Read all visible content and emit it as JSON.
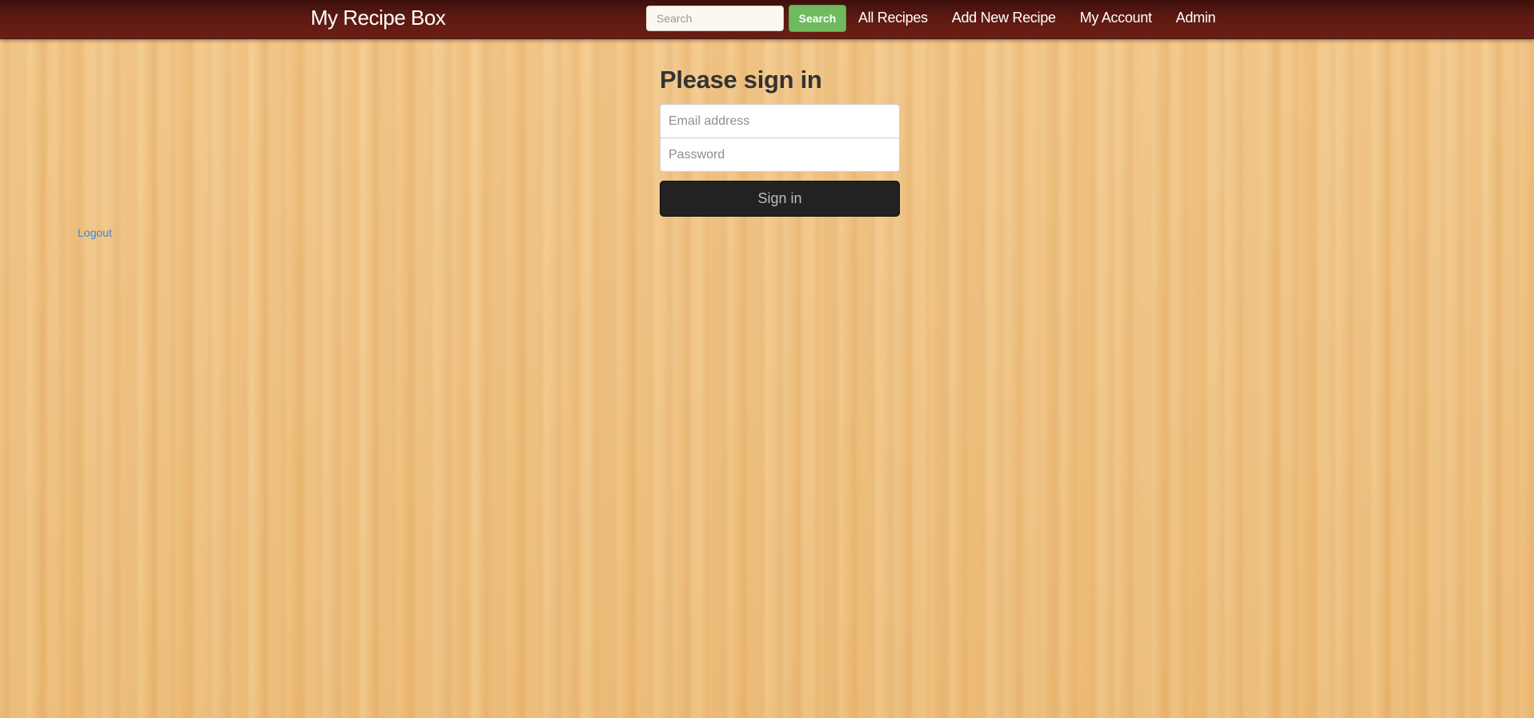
{
  "navbar": {
    "brand": "My Recipe Box",
    "search": {
      "placeholder": "Search",
      "value": "",
      "button_label": "Search"
    },
    "links": [
      {
        "label": "All Recipes"
      },
      {
        "label": "Add New Recipe"
      },
      {
        "label": "My Account"
      },
      {
        "label": "Admin"
      }
    ],
    "colors": {
      "bar": "#5e1912",
      "search_button": "#6dbb5e"
    }
  },
  "signin": {
    "heading": "Please sign in",
    "email_placeholder": "Email address",
    "email_value": "",
    "password_placeholder": "Password",
    "password_value": "",
    "button_label": "Sign in",
    "button_color": "#222222"
  },
  "sidebar": {
    "logout_label": "Logout",
    "link_color": "#3f86d6"
  },
  "background": {
    "style": "light wood grain",
    "color": "#efc286"
  }
}
